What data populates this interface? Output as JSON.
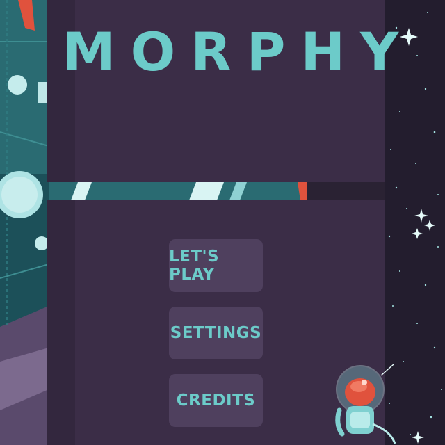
{
  "game": {
    "title": "MORPHY"
  },
  "menu": {
    "items": [
      {
        "label": "LET'S PLAY"
      },
      {
        "label": "SETTINGS"
      },
      {
        "label": "CREDITS"
      }
    ]
  },
  "colors": {
    "accent_teal": "#6ccbc9",
    "panel": "#3b2d47",
    "button": "#4f405e",
    "space": "#231d2e",
    "mascot_red": "#e0523d"
  }
}
